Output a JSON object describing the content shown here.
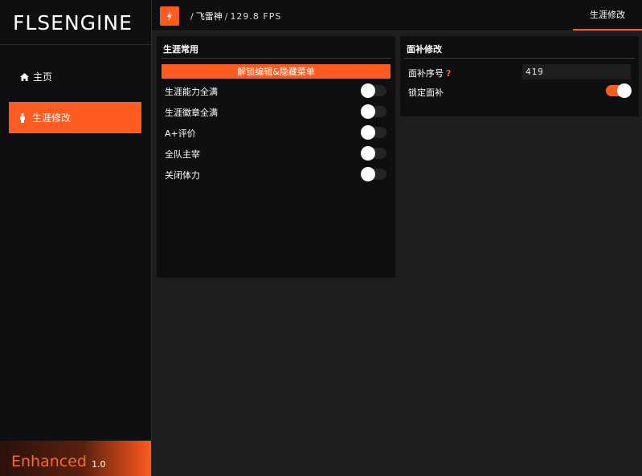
{
  "sidebar": {
    "logo": "FLSENGINE",
    "items": [
      {
        "label": "主页",
        "icon": "home-icon",
        "active": false
      },
      {
        "label": "生涯修改",
        "icon": "person-icon",
        "active": true
      }
    ],
    "brand": {
      "name": "Enhanced",
      "version": "1.0"
    }
  },
  "header": {
    "bolt_icon": "lightning-icon",
    "breadcrumb": {
      "sep1": "/",
      "game": "飞雷神",
      "sep2": "/",
      "fps": "129.8 FPS"
    },
    "tab": "生涯修改"
  },
  "career_panel": {
    "title": "生涯常用",
    "action_button": "解锁编辑&隐藏菜单",
    "toggles": [
      {
        "label": "生涯能力全满",
        "on": false
      },
      {
        "label": "生涯徽章全满",
        "on": false
      },
      {
        "label": "A+评价",
        "on": false
      },
      {
        "label": "全队主宰",
        "on": false
      },
      {
        "label": "关闭体力",
        "on": false
      }
    ]
  },
  "face_panel": {
    "title": "面补修改",
    "face_id_label": "面补序号",
    "help": "?",
    "face_id_value": "419",
    "lock_label": "锁定面补",
    "lock_on": true
  },
  "colors": {
    "accent": "#ff5a1f",
    "background": "#1e1e20",
    "panel": "#0f0f11"
  }
}
